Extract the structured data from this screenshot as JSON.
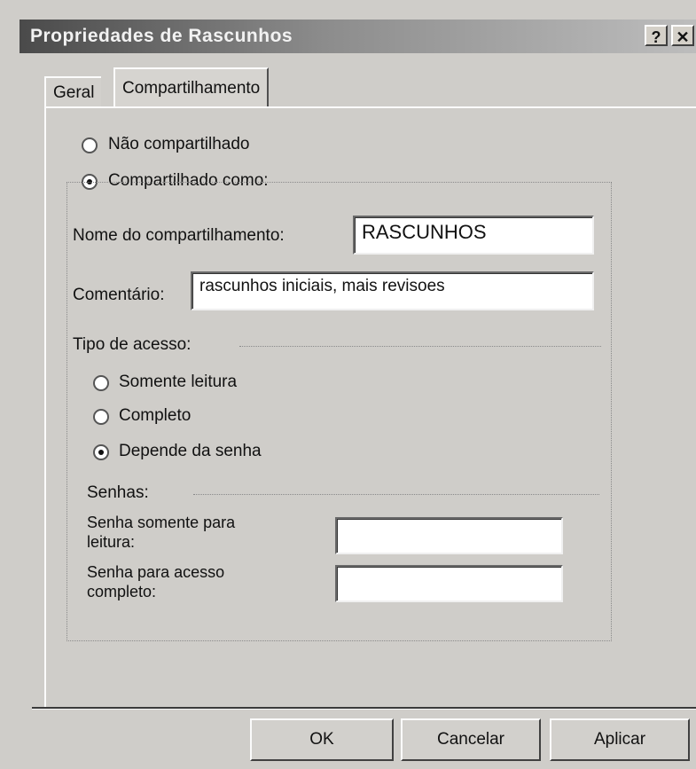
{
  "window": {
    "title": "Propriedades de Rascunhos",
    "help_button": "?",
    "close_button": "✕"
  },
  "tabs": [
    {
      "label": "Geral",
      "active": false
    },
    {
      "label": "Compartilhamento",
      "active": true
    }
  ],
  "sharing": {
    "not_shared_label": "Não compartilhado",
    "not_shared_selected": false,
    "shared_as_label": "Compartilhado como:",
    "shared_as_selected": true,
    "share_name_label": "Nome do compartilhamento:",
    "share_name_value": "RASCUNHOS",
    "comment_label": "Comentário:",
    "comment_value": "rascunhos iniciais, mais revisoes",
    "access_type_label": "Tipo de acesso:",
    "access_options": [
      {
        "label": "Somente leitura",
        "selected": false
      },
      {
        "label": "Completo",
        "selected": false
      },
      {
        "label": "Depende da senha",
        "selected": true
      }
    ],
    "passwords_label": "Senhas:",
    "readonly_password_label_line1": "Senha somente para",
    "readonly_password_label_line2": "leitura:",
    "readonly_password_value": "",
    "full_password_label_line1": "Senha para acesso",
    "full_password_label_line2": "completo:",
    "full_password_value": ""
  },
  "buttons": {
    "ok": "OK",
    "cancel": "Cancelar",
    "apply": "Aplicar"
  },
  "colors": {
    "dialog_bg": "#cfcdc9",
    "titlebar_start": "#4a4a4a",
    "titlebar_end": "#bdbdbd"
  }
}
